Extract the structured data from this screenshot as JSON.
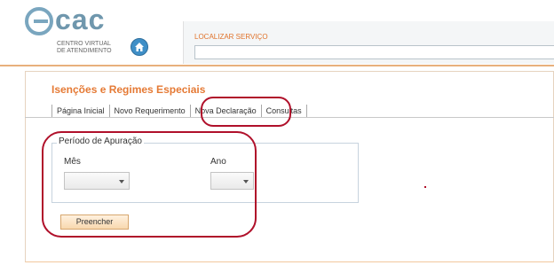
{
  "header": {
    "logo_main": "cac",
    "logo_line1": "CENTRO VIRTUAL",
    "logo_line2": "DE ATENDIMENTO",
    "search_label": "LOCALIZAR SERVIÇO",
    "search_value": ""
  },
  "page": {
    "title": "Isenções e Regimes Especiais"
  },
  "tabs": [
    {
      "label": "Página Inicial"
    },
    {
      "label": "Novo Requerimento"
    },
    {
      "label": "Nova Declaração"
    },
    {
      "label": "Consultas"
    }
  ],
  "form": {
    "legend": "Período de Apuração",
    "month_label": "Mês",
    "month_value": "",
    "year_label": "Ano",
    "year_value": "",
    "submit_label": "Preencher"
  },
  "colors": {
    "accent_orange": "#e57a35",
    "logo_blue": "#6f97ad",
    "annotation_red": "#b0102a"
  }
}
